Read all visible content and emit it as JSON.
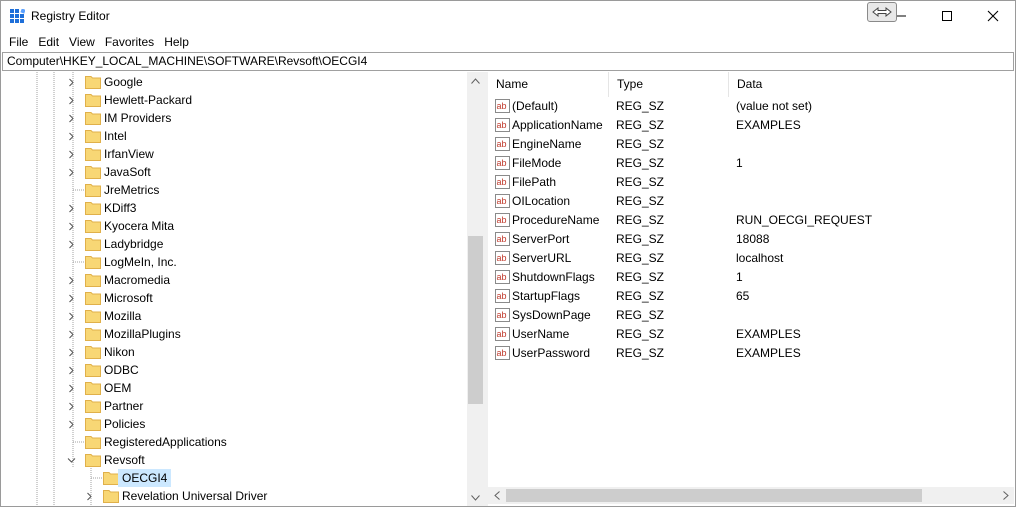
{
  "window": {
    "title": "Registry Editor",
    "icon": "regedit-icon"
  },
  "menu": [
    "File",
    "Edit",
    "View",
    "Favorites",
    "Help"
  ],
  "address": "Computer\\HKEY_LOCAL_MACHINE\\SOFTWARE\\Revsoft\\OECGI4",
  "tree": {
    "items": [
      {
        "label": "Google",
        "expander": "collapsed",
        "level": 1
      },
      {
        "label": "Hewlett-Packard",
        "expander": "collapsed",
        "level": 1
      },
      {
        "label": "IM Providers",
        "expander": "collapsed",
        "level": 1
      },
      {
        "label": "Intel",
        "expander": "collapsed",
        "level": 1
      },
      {
        "label": "IrfanView",
        "expander": "collapsed",
        "level": 1
      },
      {
        "label": "JavaSoft",
        "expander": "collapsed",
        "level": 1
      },
      {
        "label": "JreMetrics",
        "expander": "none",
        "level": 1
      },
      {
        "label": "KDiff3",
        "expander": "collapsed",
        "level": 1
      },
      {
        "label": "Kyocera Mita",
        "expander": "collapsed",
        "level": 1
      },
      {
        "label": "Ladybridge",
        "expander": "collapsed",
        "level": 1
      },
      {
        "label": "LogMeIn, Inc.",
        "expander": "none",
        "level": 1
      },
      {
        "label": "Macromedia",
        "expander": "collapsed",
        "level": 1
      },
      {
        "label": "Microsoft",
        "expander": "collapsed",
        "level": 1
      },
      {
        "label": "Mozilla",
        "expander": "collapsed",
        "level": 1
      },
      {
        "label": "MozillaPlugins",
        "expander": "collapsed",
        "level": 1
      },
      {
        "label": "Nikon",
        "expander": "collapsed",
        "level": 1
      },
      {
        "label": "ODBC",
        "expander": "collapsed",
        "level": 1
      },
      {
        "label": "OEM",
        "expander": "collapsed",
        "level": 1
      },
      {
        "label": "Partner",
        "expander": "collapsed",
        "level": 1
      },
      {
        "label": "Policies",
        "expander": "collapsed",
        "level": 1
      },
      {
        "label": "RegisteredApplications",
        "expander": "none",
        "level": 1
      },
      {
        "label": "Revsoft",
        "expander": "expanded",
        "level": 1
      },
      {
        "label": "OECGI4",
        "expander": "none",
        "level": 2,
        "selected": true
      },
      {
        "label": "Revelation Universal Driver",
        "expander": "collapsed",
        "level": 2
      }
    ]
  },
  "list": {
    "headers": {
      "name": "Name",
      "type": "Type",
      "data": "Data"
    },
    "values": [
      {
        "name": "(Default)",
        "type": "REG_SZ",
        "data": "(value not set)"
      },
      {
        "name": "ApplicationName",
        "type": "REG_SZ",
        "data": "EXAMPLES"
      },
      {
        "name": "EngineName",
        "type": "REG_SZ",
        "data": ""
      },
      {
        "name": "FileMode",
        "type": "REG_SZ",
        "data": "1"
      },
      {
        "name": "FilePath",
        "type": "REG_SZ",
        "data": ""
      },
      {
        "name": "OILocation",
        "type": "REG_SZ",
        "data": ""
      },
      {
        "name": "ProcedureName",
        "type": "REG_SZ",
        "data": "RUN_OECGI_REQUEST"
      },
      {
        "name": "ServerPort",
        "type": "REG_SZ",
        "data": "18088"
      },
      {
        "name": "ServerURL",
        "type": "REG_SZ",
        "data": "localhost"
      },
      {
        "name": "ShutdownFlags",
        "type": "REG_SZ",
        "data": "1"
      },
      {
        "name": "StartupFlags",
        "type": "REG_SZ",
        "data": "65"
      },
      {
        "name": "SysDownPage",
        "type": "REG_SZ",
        "data": ""
      },
      {
        "name": "UserName",
        "type": "REG_SZ",
        "data": "EXAMPLES"
      },
      {
        "name": "UserPassword",
        "type": "REG_SZ",
        "data": "EXAMPLES"
      }
    ]
  },
  "colors": {
    "selection": "#cce8ff",
    "folder": "#f8d775",
    "folder_edge": "#e0b04a",
    "string_icon": "#c0392b"
  }
}
